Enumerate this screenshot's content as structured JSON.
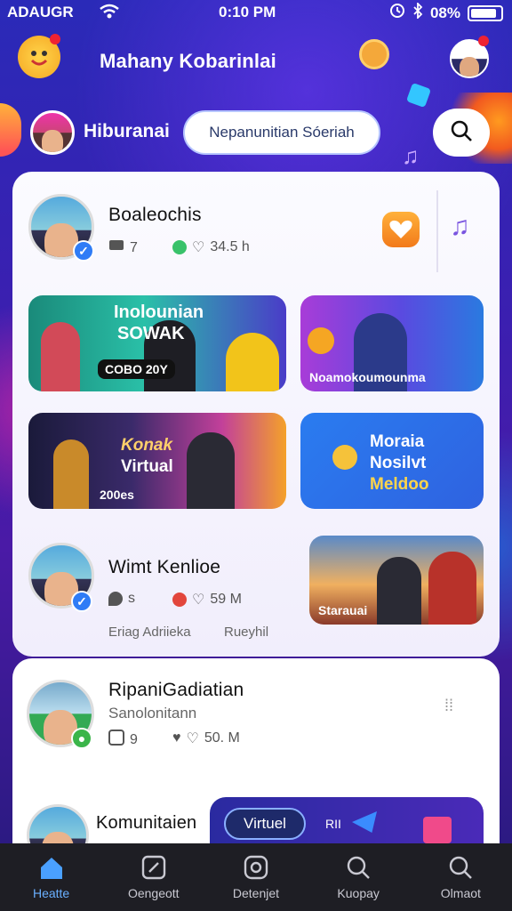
{
  "status": {
    "carrier": "ADAUGR",
    "time": "0:10 PM",
    "battery": "08%"
  },
  "header": {
    "title": "Mahany Kobarinlai"
  },
  "subheader": {
    "label": "Hiburanai",
    "pill": "Nepanunitian Sóeriah"
  },
  "feed": {
    "card1": {
      "user1": {
        "name": "Boaleochis",
        "comments": "7",
        "likes": "34.5 h"
      },
      "tiles": [
        {
          "line1": "Inolounian",
          "line2": "SOWAK",
          "tag": "COBO 20Y"
        },
        {
          "caption": "Noamokoumounma"
        },
        {
          "line1": "Konak",
          "line2": "Virtual",
          "sub": "200es"
        },
        {
          "line1": "Moraia",
          "line2": "Nosilvt",
          "line3": "Meldoo"
        }
      ],
      "user2": {
        "name": "Wimt Kenlioe",
        "comments": "s",
        "likes": "59 M",
        "tag_a": "Eriag Adriieka",
        "tag_b": "Rueyhil",
        "thumb_caption": "Starauai"
      }
    },
    "card2": {
      "user3": {
        "name": "RipaniGadiatian",
        "subtitle": "Sanolonitann",
        "comments": "9",
        "likes": "50. M"
      },
      "user4": {
        "name": "Komunitaien",
        "pill": "Virtuel",
        "tag": "RII"
      }
    }
  },
  "nav": [
    {
      "label": "Heatte",
      "active": true
    },
    {
      "label": "Oengeott"
    },
    {
      "label": "Detenjet"
    },
    {
      "label": "Kuopay"
    },
    {
      "label": "Olmaot"
    }
  ],
  "colors": {
    "accent": "#2f7cf6",
    "nav_bg": "#1e1e24",
    "active": "#6ab0ff"
  }
}
